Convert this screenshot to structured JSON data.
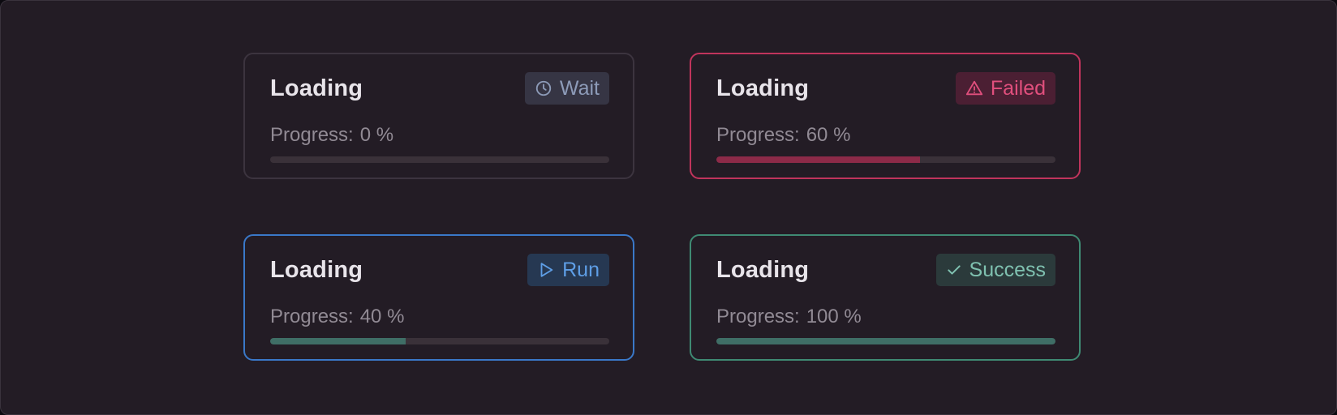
{
  "cards": [
    {
      "title": "Loading",
      "status": "Wait",
      "status_icon": "clock-icon",
      "progress_label": "Progress:",
      "progress_text": "0 %",
      "progress": 0,
      "colors": {
        "border": "#3c343f",
        "fill": "#6b6270"
      }
    },
    {
      "title": "Loading",
      "status": "Failed",
      "status_icon": "warning-triangle-icon",
      "progress_label": "Progress:",
      "progress_text": "60 %",
      "progress": 60,
      "colors": {
        "border": "#c0345c",
        "fill": "#8c2a48"
      }
    },
    {
      "title": "Loading",
      "status": "Run",
      "status_icon": "play-icon",
      "progress_label": "Progress:",
      "progress_text": "40 %",
      "progress": 40,
      "colors": {
        "border": "#3a78c8",
        "fill": "#3f6e66"
      }
    },
    {
      "title": "Loading",
      "status": "Success",
      "status_icon": "checkmark-icon",
      "progress_label": "Progress:",
      "progress_text": "100 %",
      "progress": 100,
      "colors": {
        "border": "#3f8a73",
        "fill": "#3f6e66"
      }
    }
  ]
}
